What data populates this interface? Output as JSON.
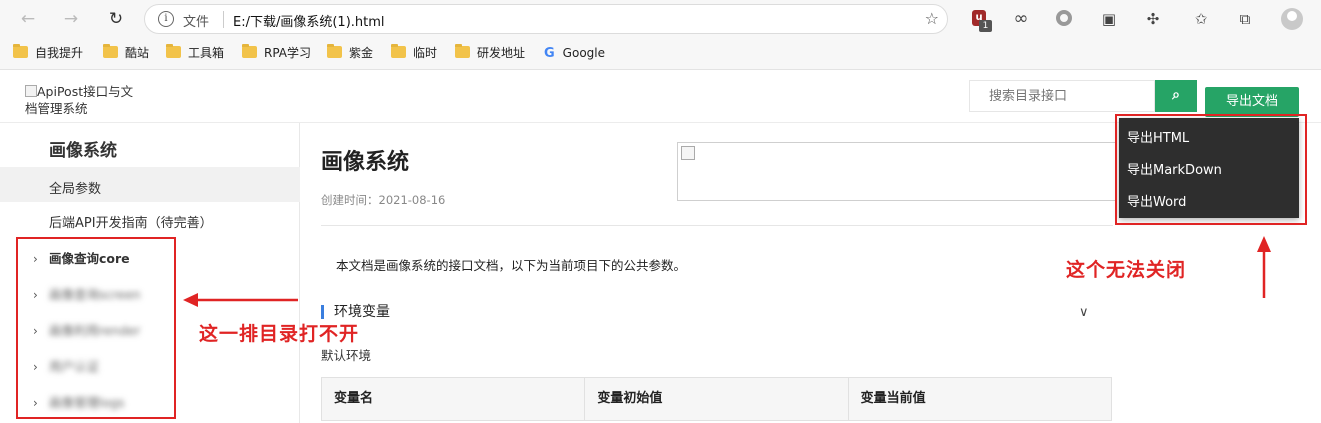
{
  "browser": {
    "address": {
      "scheme_label": "文件",
      "url": "E:/下载/画像系统(1).html"
    },
    "extension_badge": "1",
    "bookmarks": [
      "自我提升",
      "酷站",
      "工具箱",
      "RPA学习",
      "紫金",
      "临时",
      "研发地址",
      "Google"
    ]
  },
  "header": {
    "logo_alt": "ApiPost接口与文档管理系统",
    "search_placeholder": "搜索目录接口",
    "export_label": "导出文档"
  },
  "export_menu": [
    "导出HTML",
    "导出MarkDown",
    "导出Word"
  ],
  "sidebar": {
    "title": "画像系统",
    "items": [
      "全局参数",
      "后端API开发指南（待完善）"
    ],
    "tree": [
      "画像查询core",
      "画像查询screen",
      "画像利用render",
      "用户认证",
      "画像管理logs"
    ]
  },
  "content": {
    "title": "画像系统",
    "created": "创建时间：2021-08-16",
    "intro": "本文档是画像系统的接口文档，以下为当前项目下的公共参数。",
    "env_heading": "环境变量",
    "env_default": "默认环境",
    "table_headers": [
      "变量名",
      "变量初始值",
      "变量当前值"
    ]
  },
  "annotations": {
    "left_note": "这一排目录打不开",
    "right_note": "这个无法关闭",
    "color": "#e02424"
  },
  "colors": {
    "accent": "#26a466",
    "menu_bg": "#2e2e2e"
  }
}
